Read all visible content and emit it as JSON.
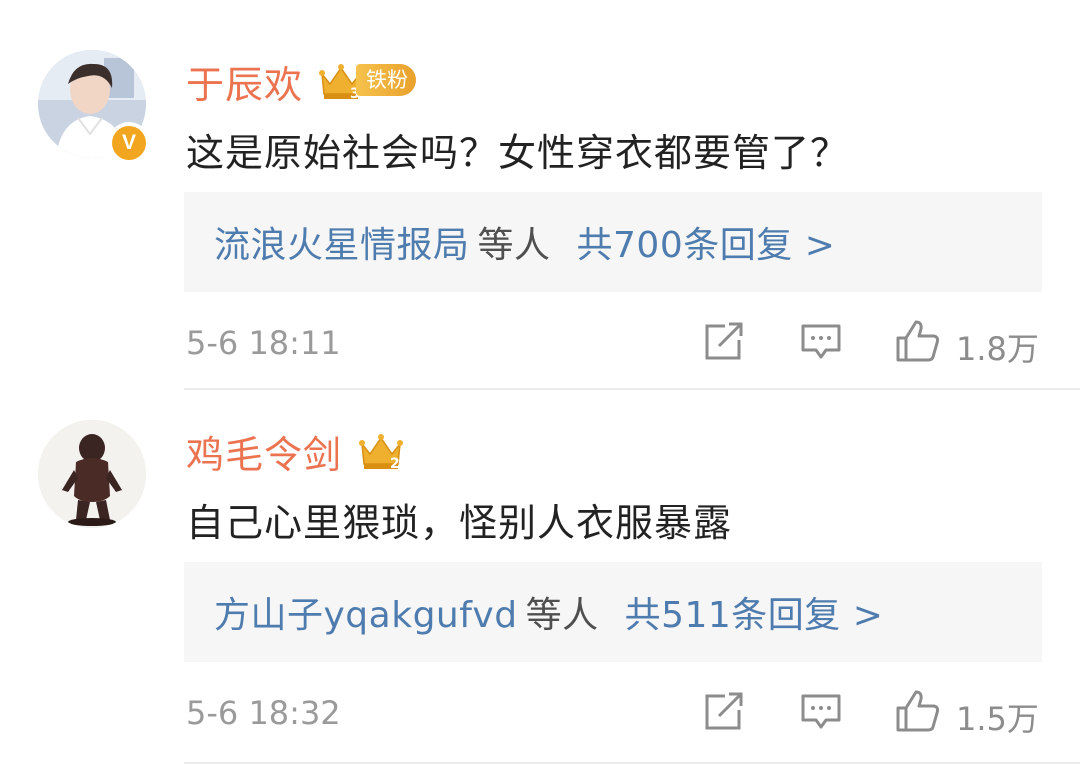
{
  "comments": [
    {
      "username": "于辰欢",
      "fan_badge_label": "铁粉",
      "crown_level": "3",
      "verified": true,
      "verified_mark": "V",
      "text": "这是原始社会吗？女性穿衣都要管了？",
      "reply_names": "流浪火星情报局",
      "reply_etc": "等人",
      "reply_total": "共700条回复 >",
      "time": "5-6 18:11",
      "like_count": "1.8万"
    },
    {
      "username": "鸡毛令剑",
      "fan_badge_label": "",
      "crown_level": "2",
      "verified": false,
      "text": "自己心里猥琐，怪别人衣服暴露",
      "reply_names": "方山子yqakgufvd",
      "reply_etc": "等人",
      "reply_total": "共511条回复 >",
      "time": "5-6 18:32",
      "like_count": "1.5万"
    }
  ],
  "icons": {
    "share": "share-icon",
    "comment": "comment-icon",
    "like": "thumbs-up-icon",
    "crown": "crown-icon",
    "verified": "verified-badge-icon"
  },
  "colors": {
    "username": "#eb7350",
    "link": "#4f7cae",
    "reply_bg": "#f6f6f6",
    "meta": "#9a9a9a",
    "crown": "#f0b02f"
  }
}
